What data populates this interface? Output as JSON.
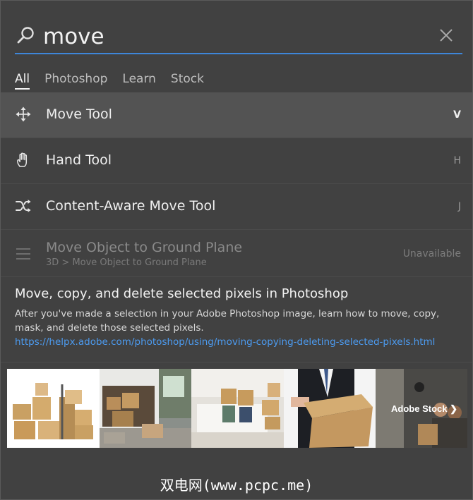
{
  "search": {
    "value": "move",
    "placeholder": ""
  },
  "tabs": [
    {
      "label": "All",
      "active": true
    },
    {
      "label": "Photoshop",
      "active": false
    },
    {
      "label": "Learn",
      "active": false
    },
    {
      "label": "Stock",
      "active": false
    }
  ],
  "results": [
    {
      "icon": "move-icon",
      "label": "Move Tool",
      "shortcut": "V",
      "selected": true
    },
    {
      "icon": "hand-icon",
      "label": "Hand Tool",
      "shortcut": "H"
    },
    {
      "icon": "content-aware-move-icon",
      "label": "Content-Aware Move Tool",
      "shortcut": "J"
    },
    {
      "icon": "menu-icon",
      "label": "Move Object to Ground Plane",
      "sublabel": "3D > Move Object to Ground Plane",
      "shortcut": "Unavailable",
      "disabled": true
    }
  ],
  "learn": {
    "title": "Move, copy, and delete selected pixels in Photoshop",
    "description": "After you've made a selection in your Adobe Photoshop image, learn how to move, copy, mask, and delete those selected pixels.",
    "link": "https://helpx.adobe.com/photoshop/using/moving-copying-deleting-selected-pixels.html"
  },
  "stock": {
    "label": "Adobe Stock"
  },
  "watermark": "双电网(www.pcpc.me)",
  "colors": {
    "accent": "#3e86d9",
    "link": "#4c9bf0",
    "background": "#414141"
  }
}
